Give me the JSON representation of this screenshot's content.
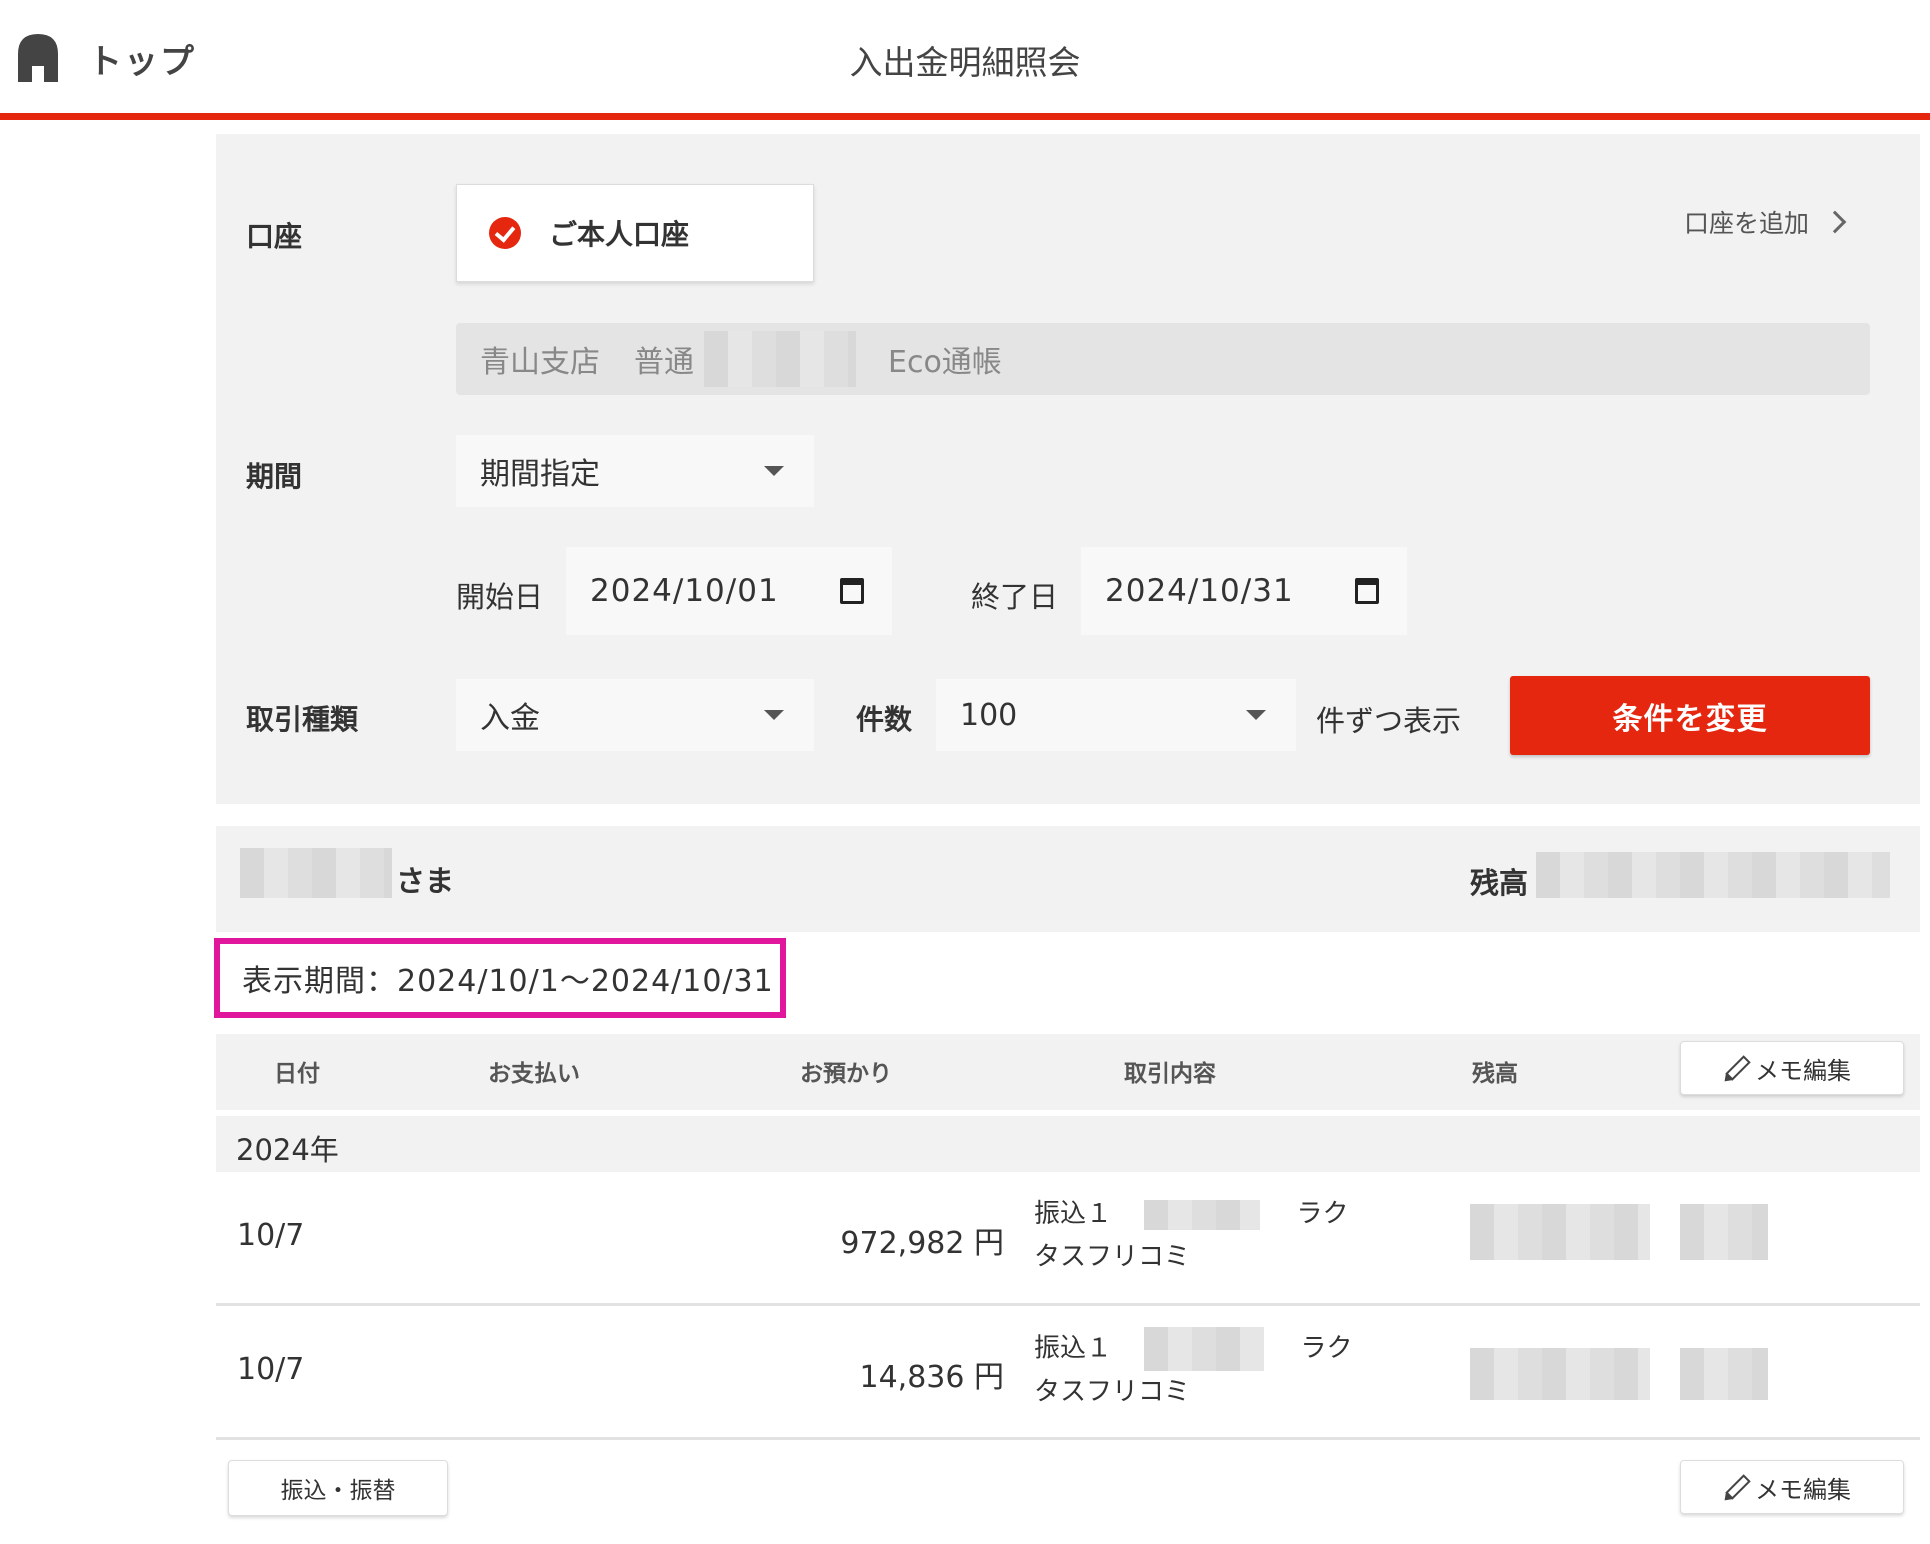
{
  "header": {
    "home_label": "トップ",
    "title": "入出金明細照会"
  },
  "conditions": {
    "account_label": "口座",
    "account_chip": "ご本人口座",
    "add_account": "口座を追加",
    "account_info": {
      "branch": "青山支店",
      "type": "普通",
      "passbook": "Eco通帳"
    },
    "period_label": "期間",
    "period_select": "期間指定",
    "start_label": "開始日",
    "start_date": "2024/10/01",
    "end_label": "終了日",
    "end_date": "2024/10/31",
    "txn_type_label": "取引種類",
    "txn_type_select": "入金",
    "count_label": "件数",
    "count_select": "100",
    "count_suffix": "件ずつ表示",
    "apply_button": "条件を変更"
  },
  "summary": {
    "honorific": "さま",
    "balance_label": "残高"
  },
  "period_display": "表示期間：2024/10/1〜2024/10/31",
  "table": {
    "headers": {
      "date": "日付",
      "payment": "お支払い",
      "deposit": "お預かり",
      "description": "取引内容",
      "balance": "残高"
    },
    "memo_button": "メモ編集",
    "year": "2024年",
    "rows": [
      {
        "date": "10/7",
        "payment": "",
        "deposit": "972,982 円",
        "desc_prefix": "振込１",
        "desc_suffix": "ラク",
        "desc_line2": "タスフリコミ"
      },
      {
        "date": "10/7",
        "payment": "",
        "deposit": "14,836 円",
        "desc_prefix": "振込１",
        "desc_suffix": "ラク",
        "desc_line2": "タスフリコミ"
      }
    ]
  },
  "footer": {
    "transfer_button": "振込・振替",
    "memo_button": "メモ編集"
  },
  "colors": {
    "accent": "#e5270f",
    "highlight": "#e0179d",
    "panel_bg": "#f2f2f2"
  }
}
